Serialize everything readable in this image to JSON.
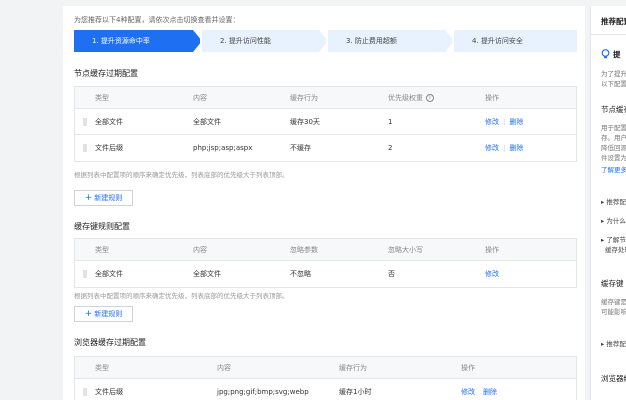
{
  "intro": "为您推荐以下4种配置，请依次点击切换查看并设置：",
  "steps": [
    {
      "label": "1. 提升资源命中率",
      "active": true
    },
    {
      "label": "2. 提升访问性能",
      "active": false
    },
    {
      "label": "3. 防止费用超额",
      "active": false
    },
    {
      "label": "4. 提升访问安全",
      "active": false
    }
  ],
  "node_cache": {
    "title": "节点缓存过期配置",
    "headers": [
      "类型",
      "内容",
      "缓存行为",
      "优先级权重",
      "操作"
    ],
    "info_icon": "i",
    "rows": [
      {
        "type": "全部文件",
        "content": "全部文件",
        "behavior": "缓存30天",
        "priority": "1",
        "edit": "修改",
        "delete": "删除"
      },
      {
        "type": "文件后缀",
        "content": "php;jsp;asp;aspx",
        "behavior": "不缓存",
        "priority": "2",
        "edit": "修改",
        "delete": "删除"
      }
    ],
    "note": "根据列表中配置项的顺序来确定优先级，列表底部的优先级大于列表顶部。",
    "add_label": "新建规则"
  },
  "cache_key": {
    "title": "缓存键规则配置",
    "headers": [
      "类型",
      "内容",
      "忽略参数",
      "忽略大小写",
      "操作"
    ],
    "rows": [
      {
        "type": "全部文件",
        "content": "全部文件",
        "ignore_params": "不忽略",
        "ignore_case": "否",
        "edit": "修改"
      }
    ],
    "note": "根据列表中配置项的顺序来确定优先级，列表底部的优先级大于列表顶部。",
    "add_label": "新建规则"
  },
  "browser_cache": {
    "title": "浏览器缓存过期配置",
    "headers": [
      "类型",
      "内容",
      "缓存行为",
      "操作"
    ],
    "rows": [
      {
        "type": "文件后缀",
        "content": "jpg;png;gif;bmp;svg;webp",
        "behavior": "缓存1小时",
        "edit": "修改",
        "delete": "删除"
      }
    ]
  },
  "sidebar": {
    "title": "推荐配置",
    "promo_head": "提",
    "promo_text_1": "为了提升",
    "promo_text_2": "以下配置",
    "node_head": "节点缓存",
    "node_text": [
      "用于配置",
      "存。用户",
      "降低回源",
      "件设置为"
    ],
    "learn_more": "了解更多",
    "bullets_1": [
      "推荐配",
      "为什么",
      "了解节",
      "缓存处理"
    ],
    "key_head": "缓存键",
    "key_text": [
      "缓存键是",
      "可能影响"
    ],
    "bullet_2": "推荐配",
    "browser_head": "浏览器缓"
  },
  "colors": {
    "primary": "#1f6ff2",
    "step_bg": "#e8f2fe"
  }
}
